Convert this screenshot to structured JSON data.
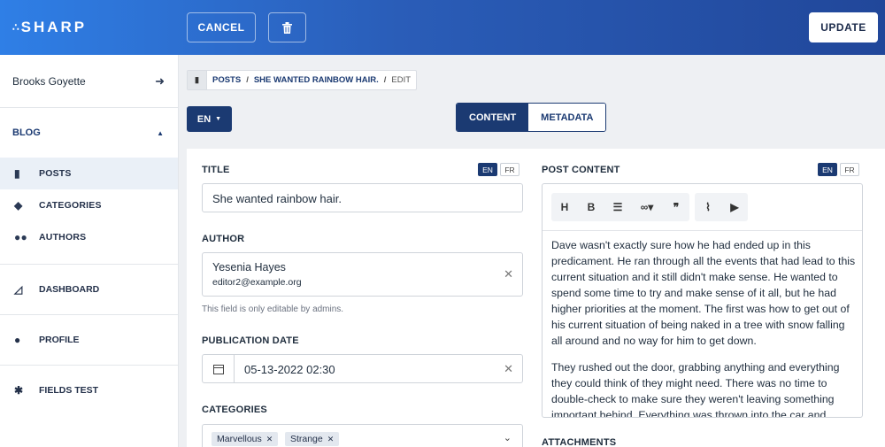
{
  "app": {
    "logo_dots": "∴",
    "logo_text": "SHARP"
  },
  "header": {
    "cancel_label": "CANCEL",
    "update_label": "UPDATE",
    "trash_icon": "trash-icon"
  },
  "sidebar": {
    "user_name": "Brooks Goyette",
    "section_title": "BLOG",
    "items": [
      {
        "label": "POSTS",
        "icon": "file-icon",
        "active": true
      },
      {
        "label": "CATEGORIES",
        "icon": "tags-icon"
      },
      {
        "label": "AUTHORS",
        "icon": "users-icon"
      }
    ],
    "blocks": [
      {
        "label": "DASHBOARD",
        "icon": "chart-icon"
      },
      {
        "label": "PROFILE",
        "icon": "user-icon"
      },
      {
        "label": "FIELDS TEST",
        "icon": "gear-icon"
      }
    ]
  },
  "breadcrumb": {
    "posts": "POSTS",
    "sep": "/",
    "title": "SHE WANTED RAINBOW HAIR.",
    "edit": "EDIT"
  },
  "locale": {
    "current": "EN"
  },
  "tabs": [
    {
      "label": "CONTENT",
      "active": true
    },
    {
      "label": "METADATA"
    }
  ],
  "form": {
    "title_label": "TITLE",
    "title_value": "She wanted rainbow hair.",
    "lang_en": "EN",
    "lang_fr": "FR",
    "author_label": "AUTHOR",
    "author_name": "Yesenia Hayes",
    "author_email": "editor2@example.org",
    "author_help": "This field is only editable by admins.",
    "date_label": "PUBLICATION DATE",
    "date_value": "05-13-2022 02:30",
    "categories_label": "CATEGORIES",
    "categories": [
      "Marvellous",
      "Strange"
    ]
  },
  "content": {
    "label": "POST CONTENT",
    "paragraphs": [
      "Dave wasn't exactly sure how he had ended up in this predicament. He ran through all the events that had lead to this current situation and it still didn't make sense. He wanted to spend some time to try and make sense of it all, but he had higher priorities at the moment. The first was how to get out of his current situation of being naked in a tree with snow falling all around and no way for him to get down.",
      "They rushed out the door, grabbing anything and everything they could think of they might need. There was no time to double-check to make sure they weren't leaving something important behind. Everything was thrown into the car and"
    ],
    "attachments_label": "ATTACHMENTS"
  },
  "colors": {
    "primary": "#1b3a72",
    "header_start": "#2f7fe6",
    "header_end": "#21479a"
  }
}
